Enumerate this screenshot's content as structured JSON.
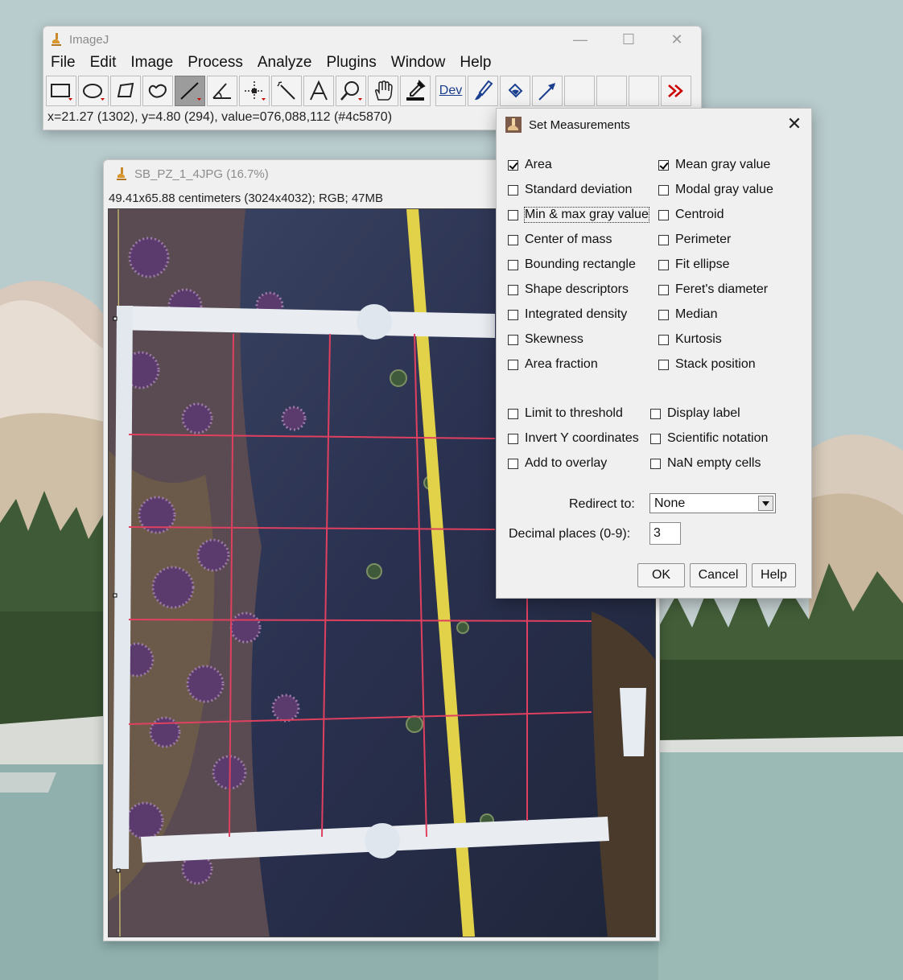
{
  "main_window": {
    "title": "ImageJ",
    "menu": [
      "File",
      "Edit",
      "Image",
      "Process",
      "Analyze",
      "Plugins",
      "Window",
      "Help"
    ],
    "tools": [
      "rectangle-tool",
      "oval-tool",
      "polygon-tool",
      "freehand-tool",
      "straight-line-tool",
      "angle-tool",
      "point-tool",
      "wand-tool",
      "text-tool",
      "magnifying-glass-tool",
      "scrolling-tool",
      "color-picker-tool",
      "developer-menu",
      "paintbrush-tool",
      "flood-fill-tool",
      "arrow-tool",
      "empty-slot",
      "empty-slot",
      "empty-slot",
      "more-tools"
    ],
    "dev_label": "Dev",
    "status": "x=21.27 (1302), y=4.80 (294), value=076,088,112 (#4c5870)"
  },
  "image_window": {
    "title": "SB_PZ_1_4JPG (16.7%)",
    "info": "49.41x65.88 centimeters (3024x4032); RGB; 47MB"
  },
  "dialog": {
    "title": "Set Measurements",
    "left_checks": [
      {
        "label": "Area",
        "checked": true
      },
      {
        "label": "Standard deviation",
        "checked": false
      },
      {
        "label": "Min & max gray value",
        "checked": false
      },
      {
        "label": "Center of mass",
        "checked": false
      },
      {
        "label": "Bounding rectangle",
        "checked": false
      },
      {
        "label": "Shape descriptors",
        "checked": false
      },
      {
        "label": "Integrated density",
        "checked": false
      },
      {
        "label": "Skewness",
        "checked": false
      },
      {
        "label": "Area fraction",
        "checked": false
      }
    ],
    "right_checks": [
      {
        "label": "Mean gray value",
        "checked": true
      },
      {
        "label": "Modal gray value",
        "checked": false
      },
      {
        "label": "Centroid",
        "checked": false
      },
      {
        "label": "Perimeter",
        "checked": false
      },
      {
        "label": "Fit ellipse",
        "checked": false
      },
      {
        "label": "Feret's diameter",
        "checked": false
      },
      {
        "label": "Median",
        "checked": false
      },
      {
        "label": "Kurtosis",
        "checked": false
      },
      {
        "label": "Stack position",
        "checked": false
      }
    ],
    "left_options": [
      {
        "label": "Limit to threshold",
        "checked": false
      },
      {
        "label": "Invert Y coordinates",
        "checked": false
      },
      {
        "label": "Add to overlay",
        "checked": false
      }
    ],
    "right_options": [
      {
        "label": "Display label",
        "checked": false
      },
      {
        "label": "Scientific notation",
        "checked": false
      },
      {
        "label": "NaN empty cells",
        "checked": false
      }
    ],
    "redirect_label": "Redirect to:",
    "redirect_value": "None",
    "decimal_label": "Decimal places (0-9):",
    "decimal_value": "3",
    "ok": "OK",
    "cancel": "Cancel",
    "help": "Help"
  }
}
